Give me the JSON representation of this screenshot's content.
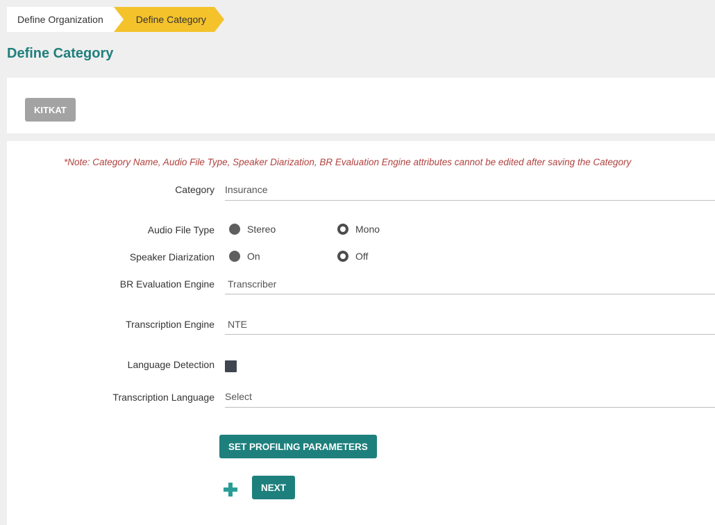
{
  "breadcrumb": {
    "step1": "Define Organization",
    "step2": "Define Category"
  },
  "page_title": "Define Category",
  "organization": {
    "name": "KITKAT"
  },
  "form": {
    "note": "*Note: Category Name, Audio File Type, Speaker Diarization, BR Evaluation Engine attributes cannot be edited after saving the Category",
    "category": {
      "label": "Category",
      "value": "Insurance"
    },
    "audio_file_type": {
      "label": "Audio File Type",
      "options": [
        "Stereo",
        "Mono"
      ],
      "selected": "Mono"
    },
    "speaker_diarization": {
      "label": "Speaker Diarization",
      "options": [
        "On",
        "Off"
      ],
      "selected": "Off"
    },
    "br_engine": {
      "label": "BR Evaluation Engine",
      "value": "Transcriber"
    },
    "transcription_engine": {
      "label": "Transcription Engine",
      "value": "NTE"
    },
    "language_detection": {
      "label": "Language Detection",
      "checked": true
    },
    "transcription_language": {
      "label": "Transcription Language",
      "value": "Select"
    }
  },
  "buttons": {
    "profiling": "SET PROFILING PARAMETERS",
    "next": "NEXT"
  },
  "colors": {
    "accent": "#1e807d",
    "breadcrumb_active": "#f4c22b",
    "note": "#b0413e",
    "org_button": "#a3a3a3"
  }
}
